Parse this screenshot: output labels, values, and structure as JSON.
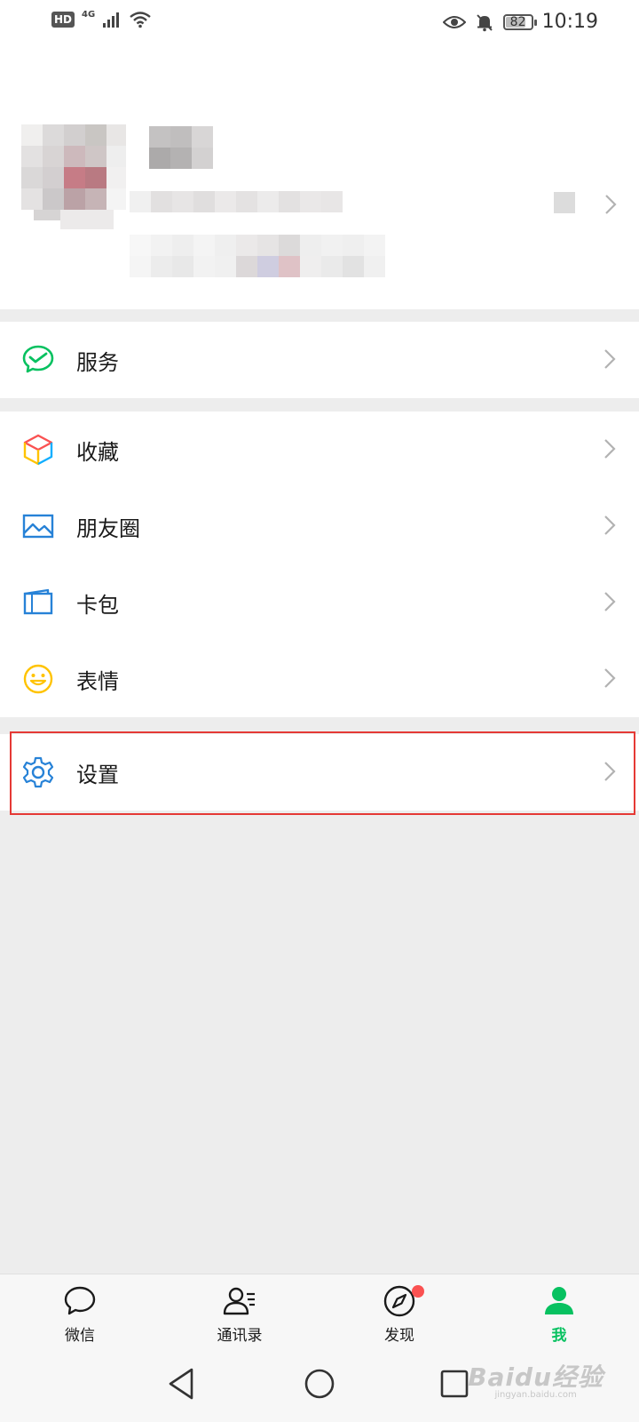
{
  "status_bar": {
    "hd": "HD",
    "network": "4G",
    "battery": "82",
    "time": "10:19"
  },
  "menu_groups": [
    {
      "items": [
        {
          "label": "服务",
          "icon": "wechat-pay-icon"
        }
      ]
    },
    {
      "items": [
        {
          "label": "收藏",
          "icon": "favorites-cube-icon"
        },
        {
          "label": "朋友圈",
          "icon": "moments-picture-icon"
        },
        {
          "label": "卡包",
          "icon": "card-wallet-icon"
        },
        {
          "label": "表情",
          "icon": "smiley-icon"
        }
      ]
    },
    {
      "items": [
        {
          "label": "设置",
          "icon": "gear-icon"
        }
      ]
    }
  ],
  "tabs": [
    {
      "label": "微信",
      "icon": "chat-bubble-icon",
      "active": false
    },
    {
      "label": "通讯录",
      "icon": "contacts-icon",
      "active": false
    },
    {
      "label": "发现",
      "icon": "compass-icon",
      "active": false,
      "badge_dot": true
    },
    {
      "label": "我",
      "icon": "person-icon",
      "active": true
    }
  ],
  "watermark": {
    "main": "Baidu经验",
    "sub": "jingyan.baidu.com"
  },
  "colors": {
    "accent_green": "#07c160",
    "highlight_red": "#e53935",
    "badge_red": "#fa5151",
    "background": "#ededed"
  }
}
